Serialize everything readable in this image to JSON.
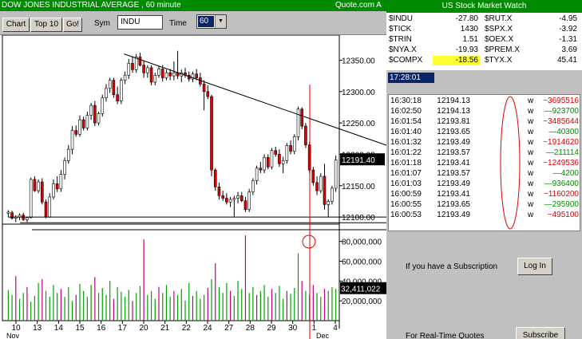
{
  "chart_header": {
    "title": "DOW JONES INDUSTRIAL AVERAGE , 60 minute",
    "source": "Quote.com  A"
  },
  "toolbar": {
    "chart_label": "Chart",
    "top10_label": "Top 10",
    "go_label": "Go!",
    "sym_label": "Sym",
    "sym_value": "INDU",
    "time_label": "Time",
    "time_value": "60"
  },
  "price_axis": {
    "ticks": [
      "12350.00",
      "12300.00",
      "12250.00",
      "12200.00",
      "12150.00",
      "12100.00"
    ],
    "current_label": "12191.40"
  },
  "volume_axis": {
    "ticks": [
      "80,000,000",
      "60,000,000",
      "40,000,000",
      "20,000,000"
    ],
    "current_label": "32,411,022"
  },
  "date_axis": {
    "labels": [
      "10",
      "13",
      "14",
      "15",
      "16",
      "17",
      "20",
      "21",
      "22",
      "24",
      "27",
      "28",
      "29",
      "30",
      "1",
      "4"
    ],
    "month_labels": [
      "Nov",
      "Dec"
    ]
  },
  "chart_data": {
    "type": "candlestick",
    "interval": "60 minute",
    "symbol": "INDU",
    "ylim": [
      12090,
      12390
    ],
    "volume_ylim": [
      0,
      95000000
    ],
    "trendline": {
      "from": [
        0,
        12360
      ],
      "to": [
        126,
        12250
      ]
    },
    "candles": [
      [
        12106,
        12111,
        12100,
        12108
      ],
      [
        12107,
        12110,
        12096,
        12098
      ],
      [
        12098,
        12103,
        12092,
        12100
      ],
      [
        12100,
        12106,
        12095,
        12103
      ],
      [
        12103,
        12107,
        12094,
        12096
      ],
      [
        12096,
        12100,
        12092,
        12099
      ],
      [
        12099,
        12163,
        12098,
        12160
      ],
      [
        12160,
        12165,
        12140,
        12142
      ],
      [
        12142,
        12160,
        12138,
        12156
      ],
      [
        12156,
        12162,
        12120,
        12124
      ],
      [
        12124,
        12128,
        12098,
        12100
      ],
      [
        12100,
        12138,
        12099,
        12132
      ],
      [
        12132,
        12160,
        12128,
        12153
      ],
      [
        12153,
        12165,
        12140,
        12145
      ],
      [
        12145,
        12175,
        12140,
        12168
      ],
      [
        12168,
        12195,
        12160,
        12190
      ],
      [
        12190,
        12215,
        12185,
        12208
      ],
      [
        12208,
        12245,
        12200,
        12238
      ],
      [
        12238,
        12246,
        12228,
        12232
      ],
      [
        12232,
        12262,
        12228,
        12255
      ],
      [
        12255,
        12260,
        12238,
        12242
      ],
      [
        12242,
        12268,
        12238,
        12262
      ],
      [
        12262,
        12282,
        12255,
        12278
      ],
      [
        12278,
        12285,
        12245,
        12250
      ],
      [
        12250,
        12268,
        12246,
        12265
      ],
      [
        12265,
        12295,
        12260,
        12290
      ],
      [
        12290,
        12312,
        12284,
        12305
      ],
      [
        12305,
        12322,
        12298,
        12318
      ],
      [
        12318,
        12322,
        12290,
        12295
      ],
      [
        12295,
        12308,
        12280,
        12285
      ],
      [
        12285,
        12322,
        12280,
        12318
      ],
      [
        12318,
        12332,
        12312,
        12326
      ],
      [
        12326,
        12352,
        12320,
        12345
      ],
      [
        12345,
        12356,
        12330,
        12335
      ],
      [
        12335,
        12360,
        12330,
        12355
      ],
      [
        12355,
        12362,
        12340,
        12342
      ],
      [
        12342,
        12350,
        12322,
        12330
      ],
      [
        12330,
        12342,
        12322,
        12338
      ],
      [
        12338,
        12342,
        12310,
        12315
      ],
      [
        12315,
        12330,
        12310,
        12326
      ],
      [
        12326,
        12340,
        12322,
        12336
      ],
      [
        12336,
        12342,
        12316,
        12322
      ],
      [
        12322,
        12335,
        12318,
        12330
      ],
      [
        12330,
        12336,
        12318,
        12325
      ],
      [
        12325,
        12348,
        12318,
        12330
      ],
      [
        12330,
        12365,
        12320,
        12325
      ],
      [
        12325,
        12335,
        12315,
        12330
      ],
      [
        12330,
        12338,
        12322,
        12326
      ],
      [
        12326,
        12332,
        12316,
        12320
      ],
      [
        12320,
        12332,
        12315,
        12328
      ],
      [
        12328,
        12336,
        12318,
        12322
      ],
      [
        12322,
        12330,
        12308,
        12312
      ],
      [
        12312,
        12318,
        12270,
        12300
      ],
      [
        12300,
        12310,
        12288,
        12292
      ],
      [
        12292,
        12295,
        12165,
        12175
      ],
      [
        12175,
        12178,
        12142,
        12148
      ],
      [
        12148,
        12155,
        12128,
        12134
      ],
      [
        12134,
        12142,
        12126,
        12130
      ],
      [
        12130,
        12138,
        12120,
        12124
      ],
      [
        12124,
        12132,
        12116,
        12128
      ],
      [
        12128,
        12134,
        12100,
        12130
      ],
      [
        12130,
        12140,
        12122,
        12134
      ],
      [
        12134,
        12140,
        12124,
        12126
      ],
      [
        12126,
        12132,
        12108,
        12112
      ],
      [
        12112,
        12145,
        12108,
        12140
      ],
      [
        12140,
        12162,
        12135,
        12158
      ],
      [
        12158,
        12182,
        12152,
        12178
      ],
      [
        12178,
        12188,
        12170,
        12175
      ],
      [
        12175,
        12200,
        12170,
        12195
      ],
      [
        12195,
        12200,
        12176,
        12180
      ],
      [
        12180,
        12210,
        12176,
        12206
      ],
      [
        12206,
        12212,
        12196,
        12200
      ],
      [
        12200,
        12208,
        12180,
        12185
      ],
      [
        12185,
        12196,
        12170,
        12190
      ],
      [
        12190,
        12218,
        12185,
        12214
      ],
      [
        12214,
        12222,
        12200,
        12205
      ],
      [
        12205,
        12232,
        12200,
        12228
      ],
      [
        12228,
        12276,
        12222,
        12272
      ],
      [
        12272,
        12275,
        12240,
        12245
      ],
      [
        12245,
        12250,
        12210,
        12215
      ],
      [
        12215,
        12220,
        12170,
        12175
      ],
      [
        12175,
        12180,
        12150,
        12155
      ],
      [
        12155,
        12165,
        12135,
        12142
      ],
      [
        12142,
        12170,
        12138,
        12165
      ],
      [
        12165,
        12185,
        12112,
        12120
      ],
      [
        12120,
        12128,
        12100,
        12125
      ],
      [
        12125,
        12150,
        12120,
        12146
      ],
      [
        12146,
        12198,
        12140,
        12191
      ]
    ],
    "volume": [
      {
        "v": 31,
        "c": "g"
      },
      {
        "v": 26,
        "c": "g"
      },
      {
        "v": 45,
        "c": "m"
      },
      {
        "v": 22,
        "c": "g"
      },
      {
        "v": 28,
        "c": "g"
      },
      {
        "v": 34,
        "c": "m"
      },
      {
        "v": 19,
        "c": "g"
      },
      {
        "v": 25,
        "c": "g"
      },
      {
        "v": 38,
        "c": "g"
      },
      {
        "v": 42,
        "c": "m"
      },
      {
        "v": 30,
        "c": "g"
      },
      {
        "v": 24,
        "c": "g"
      },
      {
        "v": 36,
        "c": "g"
      },
      {
        "v": 28,
        "c": "g"
      },
      {
        "v": 32,
        "c": "m"
      },
      {
        "v": 24,
        "c": "g"
      },
      {
        "v": 34,
        "c": "g"
      },
      {
        "v": 20,
        "c": "g"
      },
      {
        "v": 26,
        "c": "m"
      },
      {
        "v": 37,
        "c": "g"
      },
      {
        "v": 30,
        "c": "g"
      },
      {
        "v": 24,
        "c": "g"
      },
      {
        "v": 36,
        "c": "g"
      },
      {
        "v": 44,
        "c": "m"
      },
      {
        "v": 28,
        "c": "g"
      },
      {
        "v": 33,
        "c": "g"
      },
      {
        "v": 26,
        "c": "g"
      },
      {
        "v": 40,
        "c": "g"
      },
      {
        "v": 22,
        "c": "m"
      },
      {
        "v": 34,
        "c": "g"
      },
      {
        "v": 29,
        "c": "g"
      },
      {
        "v": 24,
        "c": "g"
      },
      {
        "v": 31,
        "c": "g"
      },
      {
        "v": 20,
        "c": "m"
      },
      {
        "v": 28,
        "c": "g"
      },
      {
        "v": 35,
        "c": "g"
      },
      {
        "v": 82,
        "c": "m"
      },
      {
        "v": 26,
        "c": "g"
      },
      {
        "v": 30,
        "c": "g"
      },
      {
        "v": 22,
        "c": "g"
      },
      {
        "v": 34,
        "c": "m"
      },
      {
        "v": 28,
        "c": "g"
      },
      {
        "v": 36,
        "c": "g"
      },
      {
        "v": 24,
        "c": "g"
      },
      {
        "v": 30,
        "c": "m"
      },
      {
        "v": 26,
        "c": "g"
      },
      {
        "v": 32,
        "c": "g"
      },
      {
        "v": 20,
        "c": "g"
      },
      {
        "v": 38,
        "c": "g"
      },
      {
        "v": 25,
        "c": "m"
      },
      {
        "v": 30,
        "c": "g"
      },
      {
        "v": 22,
        "c": "g"
      },
      {
        "v": 26,
        "c": "g"
      },
      {
        "v": 33,
        "c": "m"
      },
      {
        "v": 42,
        "c": "g"
      },
      {
        "v": 58,
        "c": "m"
      },
      {
        "v": 34,
        "c": "g"
      },
      {
        "v": 28,
        "c": "g"
      },
      {
        "v": 38,
        "c": "g"
      },
      {
        "v": 30,
        "c": "m"
      },
      {
        "v": 25,
        "c": "g"
      },
      {
        "v": 40,
        "c": "g"
      },
      {
        "v": 32,
        "c": "g"
      },
      {
        "v": 86,
        "c": "m"
      },
      {
        "v": 28,
        "c": "g"
      },
      {
        "v": 34,
        "c": "g"
      },
      {
        "v": 26,
        "c": "m"
      },
      {
        "v": 30,
        "c": "g"
      },
      {
        "v": 36,
        "c": "g"
      },
      {
        "v": 24,
        "c": "g"
      },
      {
        "v": 32,
        "c": "m"
      },
      {
        "v": 28,
        "c": "g"
      },
      {
        "v": 35,
        "c": "g"
      },
      {
        "v": 22,
        "c": "g"
      },
      {
        "v": 30,
        "c": "m"
      },
      {
        "v": 27,
        "c": "g"
      },
      {
        "v": 33,
        "c": "g"
      },
      {
        "v": 68,
        "c": "g"
      },
      {
        "v": 40,
        "c": "m"
      },
      {
        "v": 30,
        "c": "g"
      },
      {
        "v": 26,
        "c": "g"
      },
      {
        "v": 36,
        "c": "m"
      },
      {
        "v": 28,
        "c": "g"
      },
      {
        "v": 24,
        "c": "g"
      },
      {
        "v": 32,
        "c": "m"
      },
      {
        "v": 30,
        "c": "g"
      },
      {
        "v": 34,
        "c": "g"
      },
      {
        "v": 32,
        "c": "g"
      }
    ]
  },
  "watch": {
    "title": "US Stock Market Watch",
    "rows": [
      {
        "s1": "$INDU",
        "v1": "-27.80",
        "s2": "$RUT.X",
        "v2": "-4.95"
      },
      {
        "s1": "$TICK",
        "v1": "1430",
        "s2": "$SPX.X",
        "v2": "-3.92"
      },
      {
        "s1": "$TRIN",
        "v1": "1.51",
        "s2": "$OEX.X",
        "v2": "-1.31"
      },
      {
        "s1": "$NYA.X",
        "v1": "-19.93",
        "s2": "$PREM.X",
        "v2": "3.69"
      },
      {
        "s1": "$COMPX",
        "v1": "-18.56",
        "s2": "$TYX.X",
        "v2": "45.41"
      }
    ],
    "clock": "17:28:01",
    "ticks": [
      {
        "time": "16:30:18",
        "price": "12194.13",
        "w": "w",
        "vol": "3695516",
        "dir": "dn"
      },
      {
        "time": "16:02:50",
        "price": "12194.13",
        "w": "w",
        "vol": "923700",
        "dir": "up"
      },
      {
        "time": "16:01:54",
        "price": "12193.81",
        "w": "w",
        "vol": "3485644",
        "dir": "dn"
      },
      {
        "time": "16:01:40",
        "price": "12193.65",
        "w": "w",
        "vol": "40300",
        "dir": "up"
      },
      {
        "time": "16:01:32",
        "price": "12193.49",
        "w": "w",
        "vol": "1914620",
        "dir": "dn"
      },
      {
        "time": "16:01:22",
        "price": "12193.57",
        "w": "w",
        "vol": "211114",
        "dir": "up"
      },
      {
        "time": "16:01:18",
        "price": "12193.41",
        "w": "w",
        "vol": "1249536",
        "dir": "dn"
      },
      {
        "time": "16:01:07",
        "price": "12193.57",
        "w": "w",
        "vol": "4200",
        "dir": "up"
      },
      {
        "time": "16:01:03",
        "price": "12193.49",
        "w": "w",
        "vol": "936400",
        "dir": "up"
      },
      {
        "time": "16:00:59",
        "price": "12193.41",
        "w": "w",
        "vol": "1160200",
        "dir": "dn"
      },
      {
        "time": "16:00:55",
        "price": "12193.65",
        "w": "w",
        "vol": "295900",
        "dir": "up"
      },
      {
        "time": "16:00:53",
        "price": "12193.49",
        "w": "w",
        "vol": "495100",
        "dir": "dn"
      }
    ],
    "subscription_text": "If you have a Subscription",
    "login_label": "Log In",
    "realtime_text": "For Real-Time Quotes",
    "subscribe_label": "Subscribe"
  },
  "colors": {
    "up_candle": "#ffffff",
    "down_candle": "#e00000",
    "volume_green": "#00a000",
    "volume_magenta": "#c00080",
    "annotation": "#e00000",
    "header_green": "#008a00"
  }
}
